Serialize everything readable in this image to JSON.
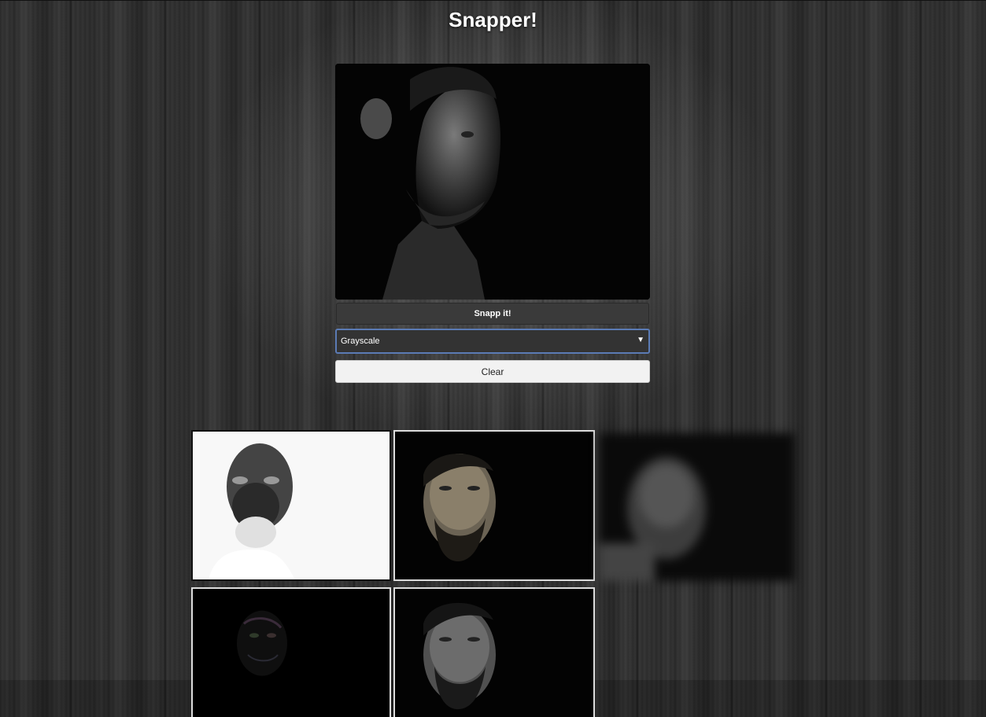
{
  "app": {
    "title": "Snapper!"
  },
  "controls": {
    "snap_label": "Snapp it!",
    "filter_selected": "Grayscale",
    "clear_label": "Clear"
  },
  "gallery": {
    "snapshots": [
      {
        "filter": "invert"
      },
      {
        "filter": "sepia"
      },
      {
        "filter": "blur"
      },
      {
        "filter": "dark"
      },
      {
        "filter": "grayscale"
      }
    ]
  },
  "colors": {
    "select_border": "#5b7bb5",
    "button_dark": "#3a3a3a",
    "button_light": "#f2f2f2"
  },
  "icons": {
    "select_arrow": "chevron-down-icon"
  }
}
